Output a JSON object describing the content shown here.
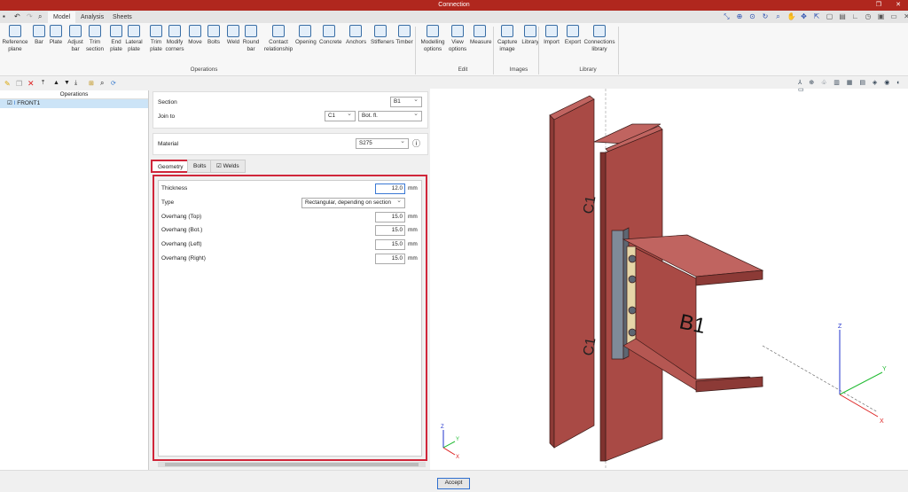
{
  "window": {
    "title": "Connection"
  },
  "quick_access": [
    "save-icon",
    "undo-icon",
    "redo-icon",
    "search-icon"
  ],
  "tabs": [
    {
      "label": "Model",
      "active": true
    },
    {
      "label": "Analysis"
    },
    {
      "label": "Sheets"
    }
  ],
  "ribbon": {
    "operations": {
      "label": "Operations",
      "buttons": [
        "Reference plane",
        "Bar",
        "Plate",
        "Adjust bar",
        "Trim section",
        "End plate",
        "Lateral plate",
        "Trim plate",
        "Modify corners",
        "Move",
        "Bolts",
        "Weld",
        "Round bar",
        "Contact relationship",
        "Opening",
        "Concrete",
        "Anchors",
        "Stiffeners",
        "Timber"
      ]
    },
    "edit": {
      "label": "Edit",
      "buttons": [
        "Modelling options",
        "View options",
        "Measure"
      ]
    },
    "images": {
      "label": "Images",
      "buttons": [
        "Capture image",
        "Library"
      ]
    },
    "library": {
      "label": "Library",
      "buttons": [
        "Import",
        "Export",
        "Connections library"
      ]
    }
  },
  "left_panel": {
    "header": "Operations",
    "items": [
      {
        "label": "FRONT1",
        "checked": true
      }
    ]
  },
  "form": {
    "section_label": "Section",
    "section_value": "B1",
    "join_label": "Join to",
    "join_value": "C1",
    "join_part": "Bot. fl.",
    "material_label": "Material",
    "material_value": "S275",
    "tabs": [
      {
        "label": "Geometry",
        "active": true
      },
      {
        "label": "Bolts"
      },
      {
        "label": "Welds",
        "checked": true
      }
    ],
    "fields": [
      {
        "label": "Thickness",
        "value": "12.0",
        "unit": "mm"
      },
      {
        "label": "Type",
        "value": "Rectangular, depending on section"
      },
      {
        "label": "Overhang (Top)",
        "value": "15.0",
        "unit": "mm"
      },
      {
        "label": "Overhang (Bot.)",
        "value": "15.0",
        "unit": "mm"
      },
      {
        "label": "Overhang (Left)",
        "value": "15.0",
        "unit": "mm"
      },
      {
        "label": "Overhang (Right)",
        "value": "15.0",
        "unit": "mm"
      }
    ]
  },
  "viewport": {
    "labels": {
      "column": "C1",
      "beam": "B1"
    },
    "axes": {
      "x": "X",
      "y": "Y",
      "z": "Z"
    },
    "steel_color": "#a94a45",
    "plate_color": "#7f8b99",
    "highlight_color": "#d0263a"
  },
  "footer": {
    "accept": "Accept"
  }
}
